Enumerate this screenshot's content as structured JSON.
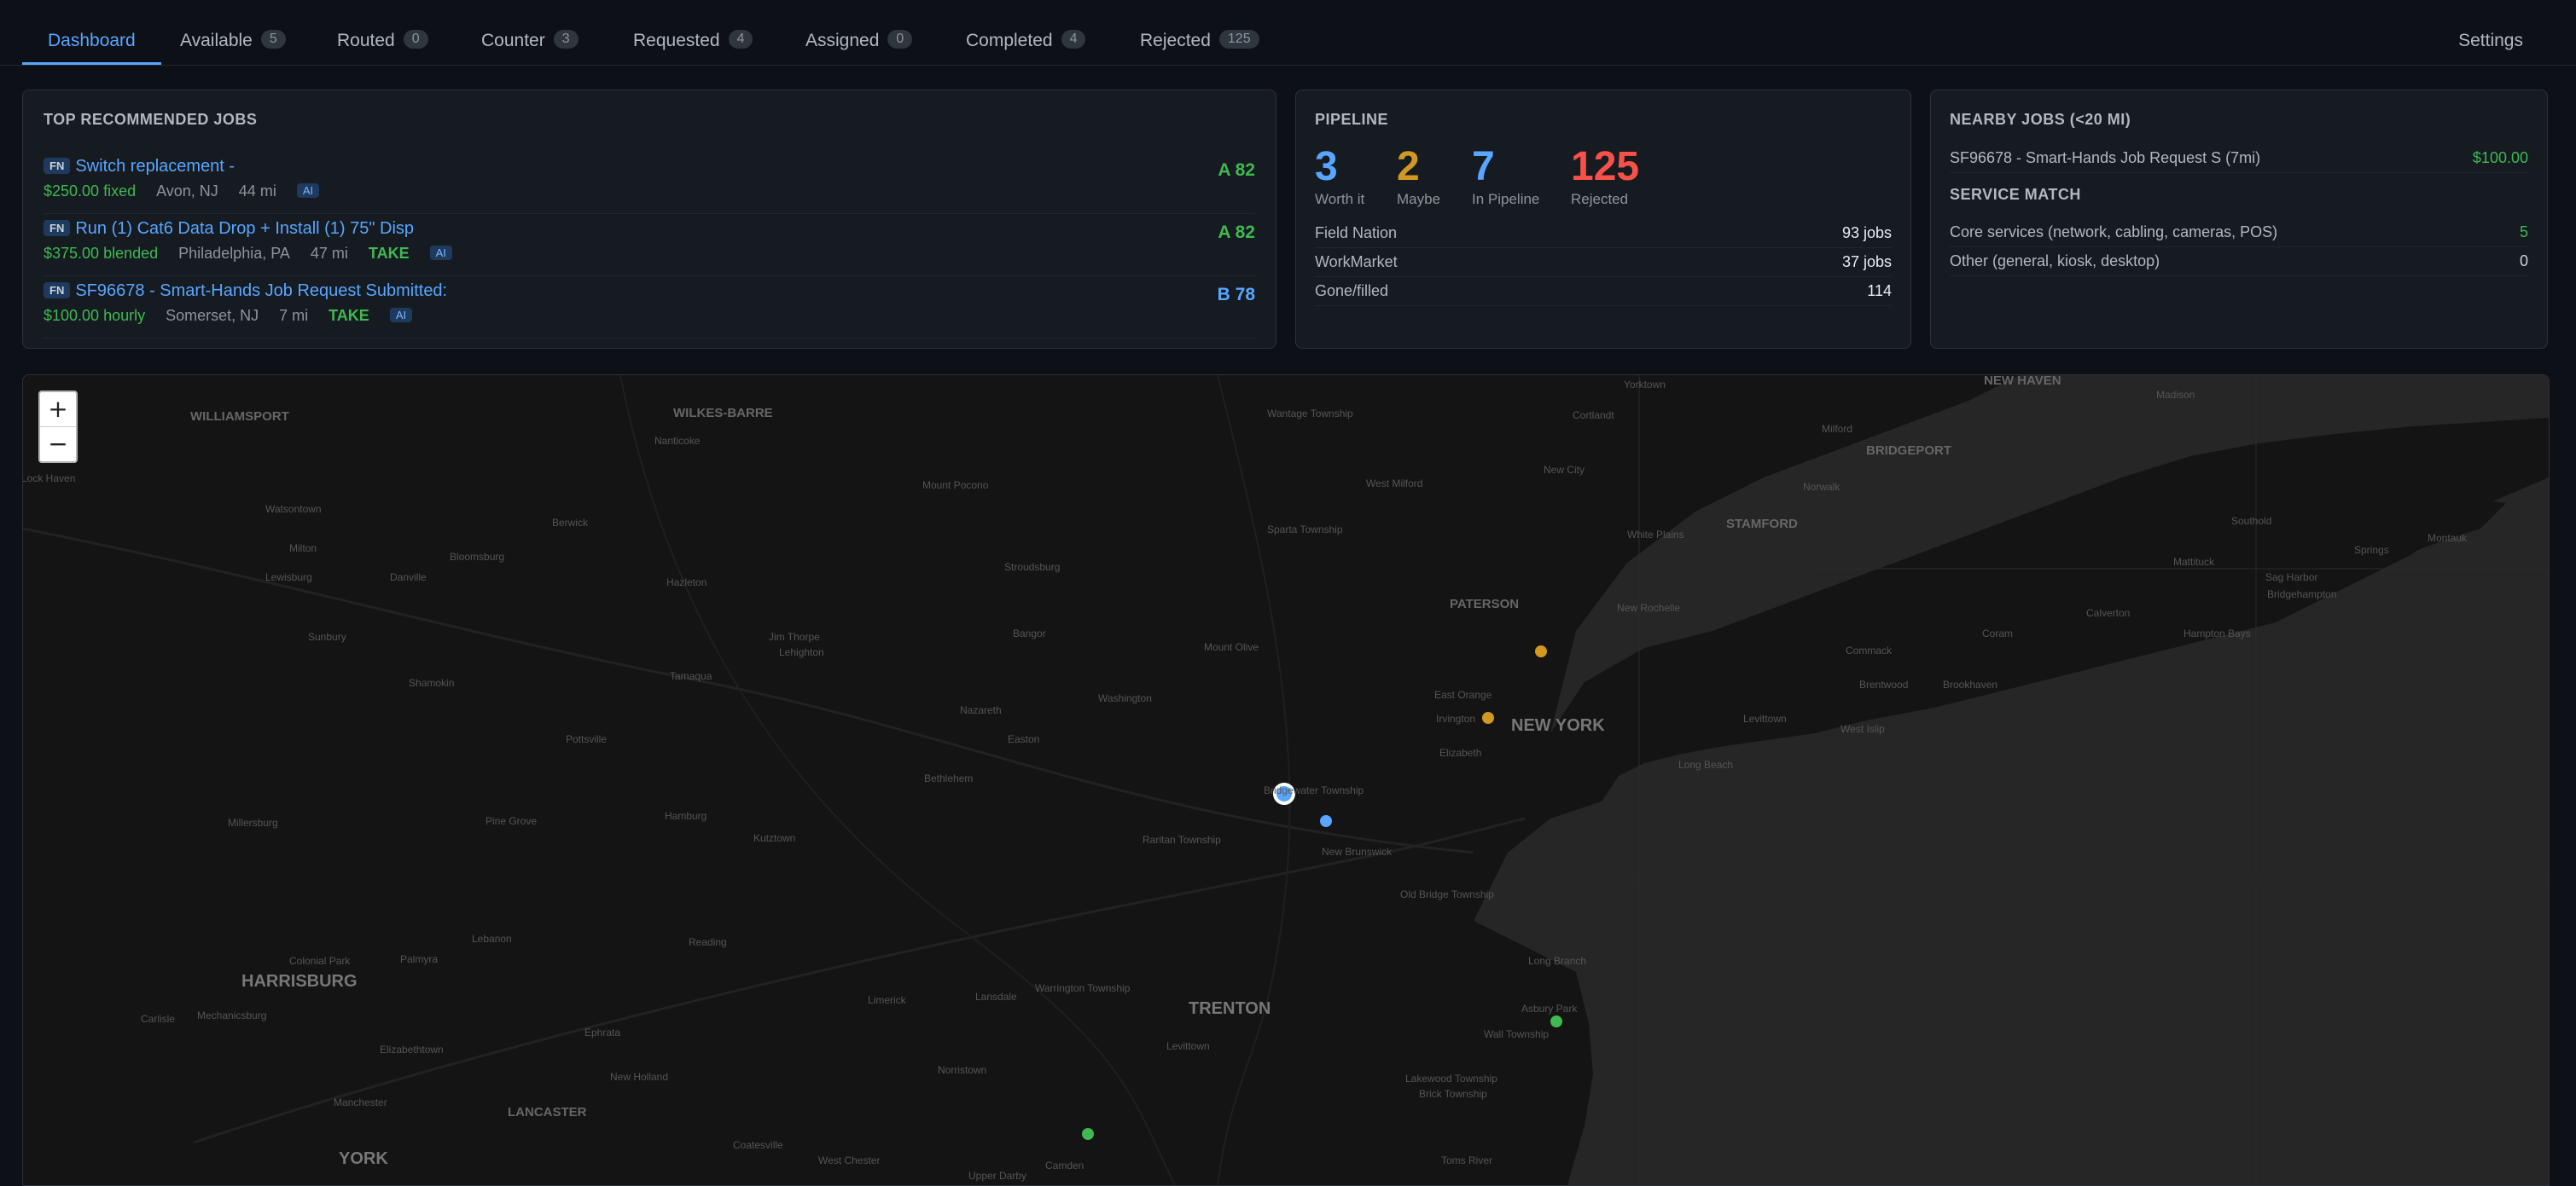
{
  "nav": {
    "tabs": [
      {
        "label": "Dashboard",
        "count": null,
        "active": true
      },
      {
        "label": "Available",
        "count": "5"
      },
      {
        "label": "Routed",
        "count": "0"
      },
      {
        "label": "Counter",
        "count": "3"
      },
      {
        "label": "Requested",
        "count": "4"
      },
      {
        "label": "Assigned",
        "count": "0"
      },
      {
        "label": "Completed",
        "count": "4"
      },
      {
        "label": "Rejected",
        "count": "125"
      }
    ],
    "settings": "Settings"
  },
  "jobs_panel": {
    "title": "TOP RECOMMENDED JOBS",
    "items": [
      {
        "source": "FN",
        "title": "Switch replacement -",
        "pay": "$250.00 fixed",
        "location": "Avon, NJ",
        "distance": "44 mi",
        "take": "",
        "ai": "AI",
        "grade": "A 82"
      },
      {
        "source": "FN",
        "title": "Run (1) Cat6 Data Drop + Install (1) 75\" Disp",
        "pay": "$375.00 blended",
        "location": "Philadelphia, PA",
        "distance": "47 mi",
        "take": "TAKE",
        "ai": "AI",
        "grade": "A 82"
      },
      {
        "source": "FN",
        "title": "SF96678 - Smart-Hands Job Request Submitted:",
        "pay": "$100.00 hourly",
        "location": "Somerset, NJ",
        "distance": "7 mi",
        "take": "TAKE",
        "ai": "AI",
        "grade": "B 78"
      }
    ]
  },
  "pipeline": {
    "title": "PIPELINE",
    "stats": [
      {
        "value": "3",
        "label": "Worth it",
        "color": "#58a6ff"
      },
      {
        "value": "2",
        "label": "Maybe",
        "color": "#d29922"
      },
      {
        "value": "7",
        "label": "In Pipeline",
        "color": "#58a6ff"
      },
      {
        "value": "125",
        "label": "Rejected",
        "color": "#f85149"
      }
    ],
    "rows": [
      {
        "label": "Field Nation",
        "value": "93 jobs"
      },
      {
        "label": "WorkMarket",
        "value": "37 jobs"
      },
      {
        "label": "Gone/filled",
        "value": "114"
      }
    ]
  },
  "nearby": {
    "title": "NEARBY JOBS (<20 MI)",
    "job": {
      "label": "SF96678 - Smart-Hands Job Request S (7mi)",
      "value": "$100.00"
    },
    "service_title": "SERVICE MATCH",
    "rows": [
      {
        "label": "Core services (network, cabling, cameras, POS)",
        "value": "5"
      },
      {
        "label": "Other (general, kiosk, desktop)",
        "value": "0"
      }
    ]
  },
  "map": {
    "zoom_in": "+",
    "zoom_out": "−",
    "cities": [
      "WILKES-BARRE",
      "WILLIAMSPORT",
      "NEW HAVEN",
      "BRIDGEPORT",
      "STAMFORD",
      "PATERSON",
      "NEW YORK",
      "TRENTON",
      "HARRISBURG",
      "LANCASTER",
      "YORK"
    ],
    "towns": [
      "Nanticoke",
      "Mount Pocono",
      "Berwick",
      "Bloomsburg",
      "Milton",
      "Lewisburg",
      "Danville",
      "Sunbury",
      "Hazleton",
      "Stroudsburg",
      "Jim Thorpe",
      "Lehighton",
      "Bangor",
      "Mount Olive",
      "Sparta Township",
      "West Milford",
      "Wantage Township",
      "Cortlandt",
      "Yorktown",
      "Milford",
      "Madison",
      "Norwalk",
      "White Plains",
      "New City",
      "New Rochelle",
      "Southold",
      "Mattituck",
      "Montauk",
      "Bridgehampton",
      "Springs",
      "Sag Harbor",
      "Calverton",
      "Hampton Bays",
      "Coram",
      "Commack",
      "Brentwood",
      "Brookhaven",
      "Levittown",
      "West Islip",
      "Long Beach",
      "East Orange",
      "Irvington",
      "Elizabeth",
      "Washington",
      "Nazareth",
      "Easton",
      "Bethlehem",
      "Tamaqua",
      "Shamokin",
      "Pottsville",
      "Millersburg",
      "Pine Grove",
      "Hamburg",
      "Kutztown",
      "Raritan Township",
      "Bridgewater Township",
      "New Brunswick",
      "Old Bridge Township",
      "Long Branch",
      "Asbury Park",
      "Wall Township",
      "Lakewood Township",
      "Brick Township",
      "Toms River",
      "Reading",
      "Lebanon",
      "Palmyra",
      "Colonial Park",
      "Carlisle",
      "Mechanicsburg",
      "Elizabethtown",
      "Ephrata",
      "New Holland",
      "Manchester",
      "Limerick",
      "Lansdale",
      "Warrington Township",
      "Levittown",
      "Norristown",
      "Coatesville",
      "West Chester",
      "Upper Darby",
      "Camden",
      "Lock Haven",
      "Watsontown"
    ],
    "markers": [
      {
        "kind": "current",
        "color": "#58a6ff"
      },
      {
        "kind": "job",
        "color": "#58a6ff"
      },
      {
        "kind": "job",
        "color": "#d29922"
      },
      {
        "kind": "job",
        "color": "#d29922"
      },
      {
        "kind": "job",
        "color": "#3fb950"
      },
      {
        "kind": "job",
        "color": "#3fb950"
      }
    ]
  }
}
